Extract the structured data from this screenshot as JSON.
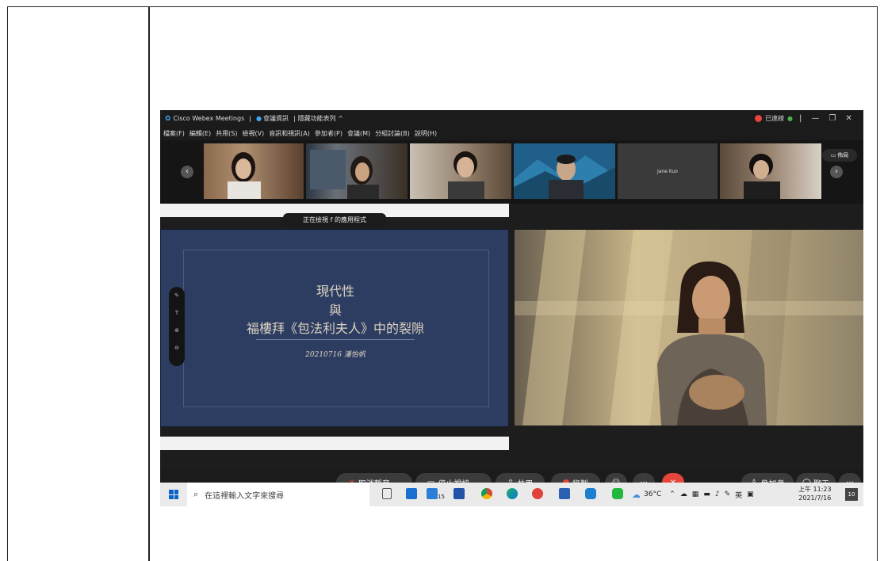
{
  "titlebar": {
    "app": "Cisco Webex Meetings",
    "meeting_info": "會議資訊",
    "hide_menu": "隱藏功能表列 ^",
    "connected": "已連線",
    "minimize": "—",
    "restore": "❐",
    "close": "✕"
  },
  "menu": [
    "檔案(F)",
    "編輯(E)",
    "共用(S)",
    "檢視(V)",
    "音訊和視訊(A)",
    "參加者(P)",
    "會議(M)",
    "分組討論(B)",
    "說明(H)"
  ],
  "participants": {
    "jane_name": "Jane Kuo",
    "layout_label": "佈局",
    "prev": "‹",
    "next": "›"
  },
  "share": {
    "viewing_label": "正在檢視 f 的應用程式",
    "slide_line1": "現代性",
    "slide_line2": "與",
    "slide_line3": "福樓拜《包法利夫人》中的裂隙",
    "slide_date": "20210716 潘怡帆",
    "tools": [
      "✎",
      "T",
      "⊕",
      "⊖"
    ]
  },
  "controls": {
    "mute": "取消靜音",
    "stop_video": "停止視訊",
    "share": "共用",
    "record": "錄製",
    "participants": "參加者",
    "chat": "聊天",
    "caret": "⌄",
    "more": "···",
    "end": "✕"
  },
  "taskbar": {
    "search_placeholder": "在這裡輸入文字來搜尋",
    "calendar_badge": "15",
    "temperature": "36°C",
    "ime": "英",
    "time": "上午 11:23",
    "date": "2021/7/16",
    "notification_count": "10"
  }
}
